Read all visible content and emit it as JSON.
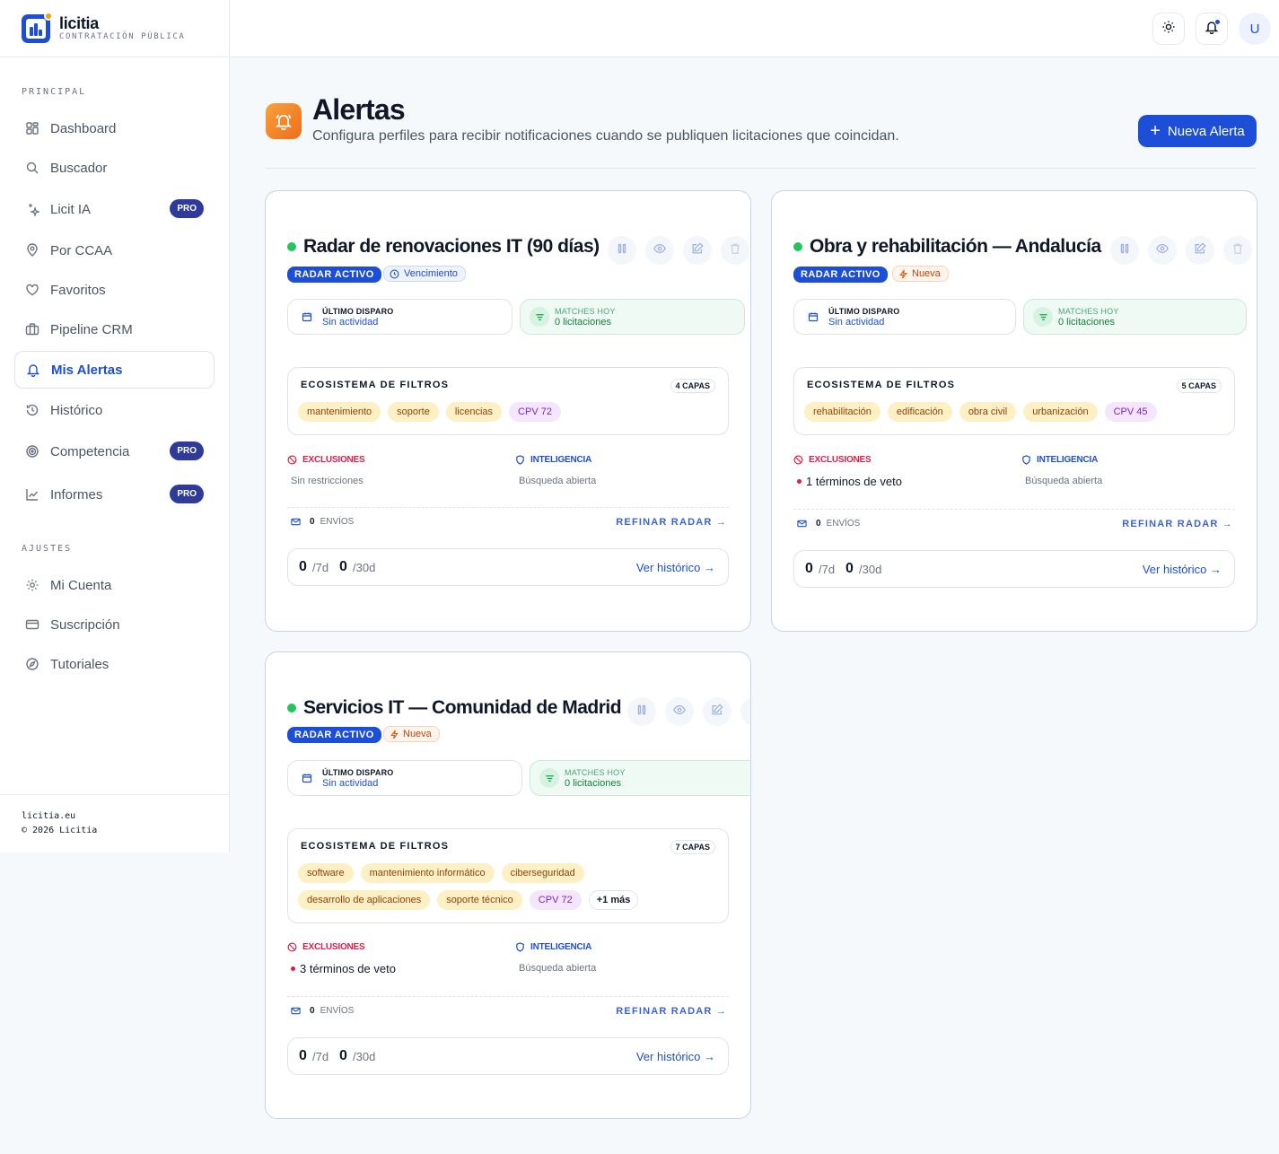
{
  "brand": {
    "name": "licitia",
    "tagline": "CONTRATACIÓN PÚBLICA"
  },
  "sidebar": {
    "principal_label": "PRINCIPAL",
    "ajustes_label": "AJUSTES",
    "items": [
      {
        "label": "Dashboard"
      },
      {
        "label": "Buscador"
      },
      {
        "label": "Licit IA",
        "badge": "PRO"
      },
      {
        "label": "Por CCAA"
      },
      {
        "label": "Favoritos"
      },
      {
        "label": "Pipeline CRM"
      },
      {
        "label": "Mis Alertas"
      },
      {
        "label": "Histórico"
      },
      {
        "label": "Competencia",
        "badge": "PRO"
      },
      {
        "label": "Informes",
        "badge": "PRO"
      }
    ],
    "settings": [
      {
        "label": "Mi Cuenta"
      },
      {
        "label": "Suscripción"
      },
      {
        "label": "Tutoriales"
      }
    ],
    "footer": {
      "site": "licitia.eu",
      "copyright": "© 2026 Licitia"
    }
  },
  "topbar": {
    "avatar_initial": "U"
  },
  "header": {
    "title": "Alertas",
    "subtitle": "Configura perfiles para recibir notificaciones cuando se publiquen licitaciones que coincidan.",
    "new_alert_label": "Nueva Alerta"
  },
  "cards": [
    {
      "title": "Radar de renovaciones IT (90 días)",
      "status_badge": "RADAR ACTIVO",
      "tag": "Vencimiento",
      "last_trigger_label": "ÚLTIMO DISPARO",
      "last_trigger_value": "Sin actividad",
      "matches_label": "MATCHES HOY",
      "matches_value": "0 licitaciones",
      "filters_title": "ECOSISTEMA DE FILTROS",
      "layers": "4 CAPAS",
      "chips_row1": [
        "mantenimiento",
        "soporte",
        "licencias",
        "CPV 72"
      ],
      "exclusions_label": "EXCLUSIONES",
      "exclusions_value": "Sin restricciones",
      "intel_label": "INTELIGENCIA",
      "intel_value": "Búsqueda abierta",
      "envios_count": "0",
      "envios_label": "ENVÍOS",
      "refine_label": "REFINAR RADAR →",
      "week_count": "0",
      "week_unit": "/7d",
      "month_count": "0",
      "month_unit": "/30d",
      "history_label": "Ver histórico →"
    },
    {
      "title": "Obra y rehabilitación — Andalucía",
      "status_badge": "RADAR ACTIVO",
      "tag": "Nueva",
      "last_trigger_label": "ÚLTIMO DISPARO",
      "last_trigger_value": "Sin actividad",
      "matches_label": "MATCHES HOY",
      "matches_value": "0 licitaciones",
      "filters_title": "ECOSISTEMA DE FILTROS",
      "layers": "5 CAPAS",
      "chips_row1": [
        "rehabilitación",
        "edificación",
        "obra civil",
        "urbanización",
        "CPV 45"
      ],
      "exclusions_label": "EXCLUSIONES",
      "exclusions_value": "1 términos de veto",
      "intel_label": "INTELIGENCIA",
      "intel_value": "Búsqueda abierta",
      "envios_count": "0",
      "envios_label": "ENVÍOS",
      "refine_label": "REFINAR RADAR →",
      "week_count": "0",
      "week_unit": "/7d",
      "month_count": "0",
      "month_unit": "/30d",
      "history_label": "Ver histórico →"
    },
    {
      "title": "Servicios IT — Comunidad de Madrid",
      "status_badge": "RADAR ACTIVO",
      "tag": "Nueva",
      "last_trigger_label": "ÚLTIMO DISPARO",
      "last_trigger_value": "Sin actividad",
      "matches_label": "MATCHES HOY",
      "matches_value": "0 licitaciones",
      "filters_title": "ECOSISTEMA DE FILTROS",
      "layers": "7 CAPAS",
      "chips_row1": [
        "software",
        "mantenimiento informático",
        "ciberseguridad"
      ],
      "chips_row2": [
        "desarrollo de aplicaciones",
        "soporte técnico",
        "CPV 72"
      ],
      "more_chip": "+1 más",
      "exclusions_label": "EXCLUSIONES",
      "exclusions_value": "3 términos de veto",
      "intel_label": "INTELIGENCIA",
      "intel_value": "Búsqueda abierta",
      "envios_count": "0",
      "envios_label": "ENVÍOS",
      "refine_label": "REFINAR RADAR →",
      "week_count": "0",
      "week_unit": "/7d",
      "month_count": "0",
      "month_unit": "/30d",
      "history_label": "Ver histórico →"
    }
  ],
  "colors": {
    "accent": "#1d4ed8",
    "active_dot": "#22c55e",
    "exclusion": "#e11d48",
    "header_icon": "#f28a2a"
  }
}
